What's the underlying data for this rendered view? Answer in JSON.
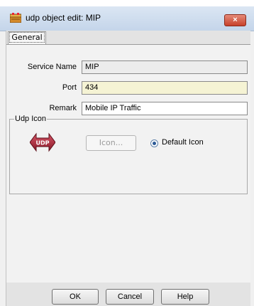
{
  "window": {
    "title": "udp object edit: MIP",
    "close_label": "×"
  },
  "tabs": [
    {
      "label": "General"
    }
  ],
  "form": {
    "service_name_label": "Service Name",
    "service_name_value": "MIP",
    "port_label": "Port",
    "port_value": "434",
    "remark_label": "Remark",
    "remark_value": "Mobile IP Traffic"
  },
  "udp_icon_group": {
    "title": "Udp Icon",
    "icon_text": "UDP",
    "icon_button_label": "Icon...",
    "default_icon_label": "Default Icon",
    "default_icon_selected": true
  },
  "footer": {
    "ok": "OK",
    "cancel": "Cancel",
    "help": "Help"
  },
  "colors": {
    "port_field_bg": "#f5f3d4",
    "readonly_field_bg": "#ececec",
    "title_bar": "#c4d5ea",
    "close_button": "#c7412b",
    "udp_icon": "#a8273a"
  }
}
